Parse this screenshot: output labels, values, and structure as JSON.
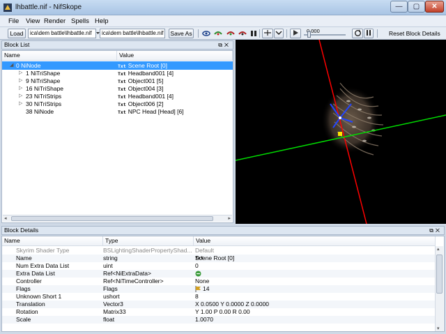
{
  "window": {
    "title": "lhbattle.nif - NifSkope",
    "min": "—",
    "max": "▢",
    "close": "✕"
  },
  "menu": [
    "File",
    "View",
    "Render",
    "Spells",
    "Help"
  ],
  "toolbar": {
    "load_label": "Load",
    "load_path": "ica\\dem battle\\lhbattle.nif",
    "save_path": "ica\\dem battle\\lhbattle.nif",
    "save_label": "Save As",
    "time_value": "0.000",
    "reset_label": "Reset Block Details"
  },
  "block_list": {
    "header": "Block List",
    "header_icons": "⧉✕",
    "columns": [
      "Name",
      "Value"
    ],
    "rows": [
      {
        "name": "0 NiNode",
        "value": "Scene Root [0]",
        "icon": "txt",
        "arrow": "◢",
        "selected": true
      },
      {
        "name": "1 NiTriShape",
        "value": "Headband001 [4]",
        "icon": "txt",
        "arrow": "▷",
        "selected": false
      },
      {
        "name": "9 NiTriShape",
        "value": "Object001 [5]",
        "icon": "txt",
        "arrow": "▷",
        "selected": false
      },
      {
        "name": "16 NiTriShape",
        "value": "Object004 [3]",
        "icon": "txt",
        "arrow": "▷",
        "selected": false
      },
      {
        "name": "23 NiTriStrips",
        "value": "Headband001 [4]",
        "icon": "txt",
        "arrow": "▷",
        "selected": false
      },
      {
        "name": "30 NiTriStrips",
        "value": "Object006 [2]",
        "icon": "txt",
        "arrow": "▷",
        "selected": false
      },
      {
        "name": "38 NiNode",
        "value": "NPC Head [Head] [6]",
        "icon": "txt",
        "arrow": "",
        "selected": false
      }
    ]
  },
  "block_details": {
    "header": "Block Details",
    "header_icons": "⧉✕",
    "columns": [
      "Name",
      "Type",
      "Value"
    ],
    "rows": [
      {
        "name": "Skyrim Shader Type",
        "type": "BSLightingShaderPropertyShad...",
        "value": "Default",
        "icon": "",
        "dim": true
      },
      {
        "name": "Name",
        "type": "string",
        "value": "Scene Root [0]",
        "icon": "txt",
        "dim": false
      },
      {
        "name": "Num Extra Data List",
        "type": "uint",
        "value": "0",
        "icon": "",
        "dim": false
      },
      {
        "name": "Extra Data List",
        "type": "Ref<NiExtraData>",
        "value": "",
        "icon": "link",
        "dim": false
      },
      {
        "name": "Controller",
        "type": "Ref<NiTimeController>",
        "value": "None",
        "icon": "",
        "dim": false
      },
      {
        "name": "Flags",
        "type": "Flags",
        "value": "14",
        "icon": "flag",
        "dim": false
      },
      {
        "name": "Unknown Short 1",
        "type": "ushort",
        "value": "8",
        "icon": "",
        "dim": false
      },
      {
        "name": "Translation",
        "type": "Vector3",
        "value": "X 0.0500 Y 0.0000 Z 0.0000",
        "icon": "",
        "dim": false
      },
      {
        "name": "Rotation",
        "type": "Matrix33",
        "value": "Y 1.00 P 0.00 R 0.00",
        "icon": "",
        "dim": false
      },
      {
        "name": "Scale",
        "type": "float",
        "value": "1.0070",
        "icon": "",
        "dim": false
      }
    ]
  },
  "colors": {
    "selection": "#3399ff",
    "axis_x": "#ff0000",
    "axis_y": "#00dd00",
    "axis_z": "#2244ff",
    "viewport_bg": "#000000"
  }
}
